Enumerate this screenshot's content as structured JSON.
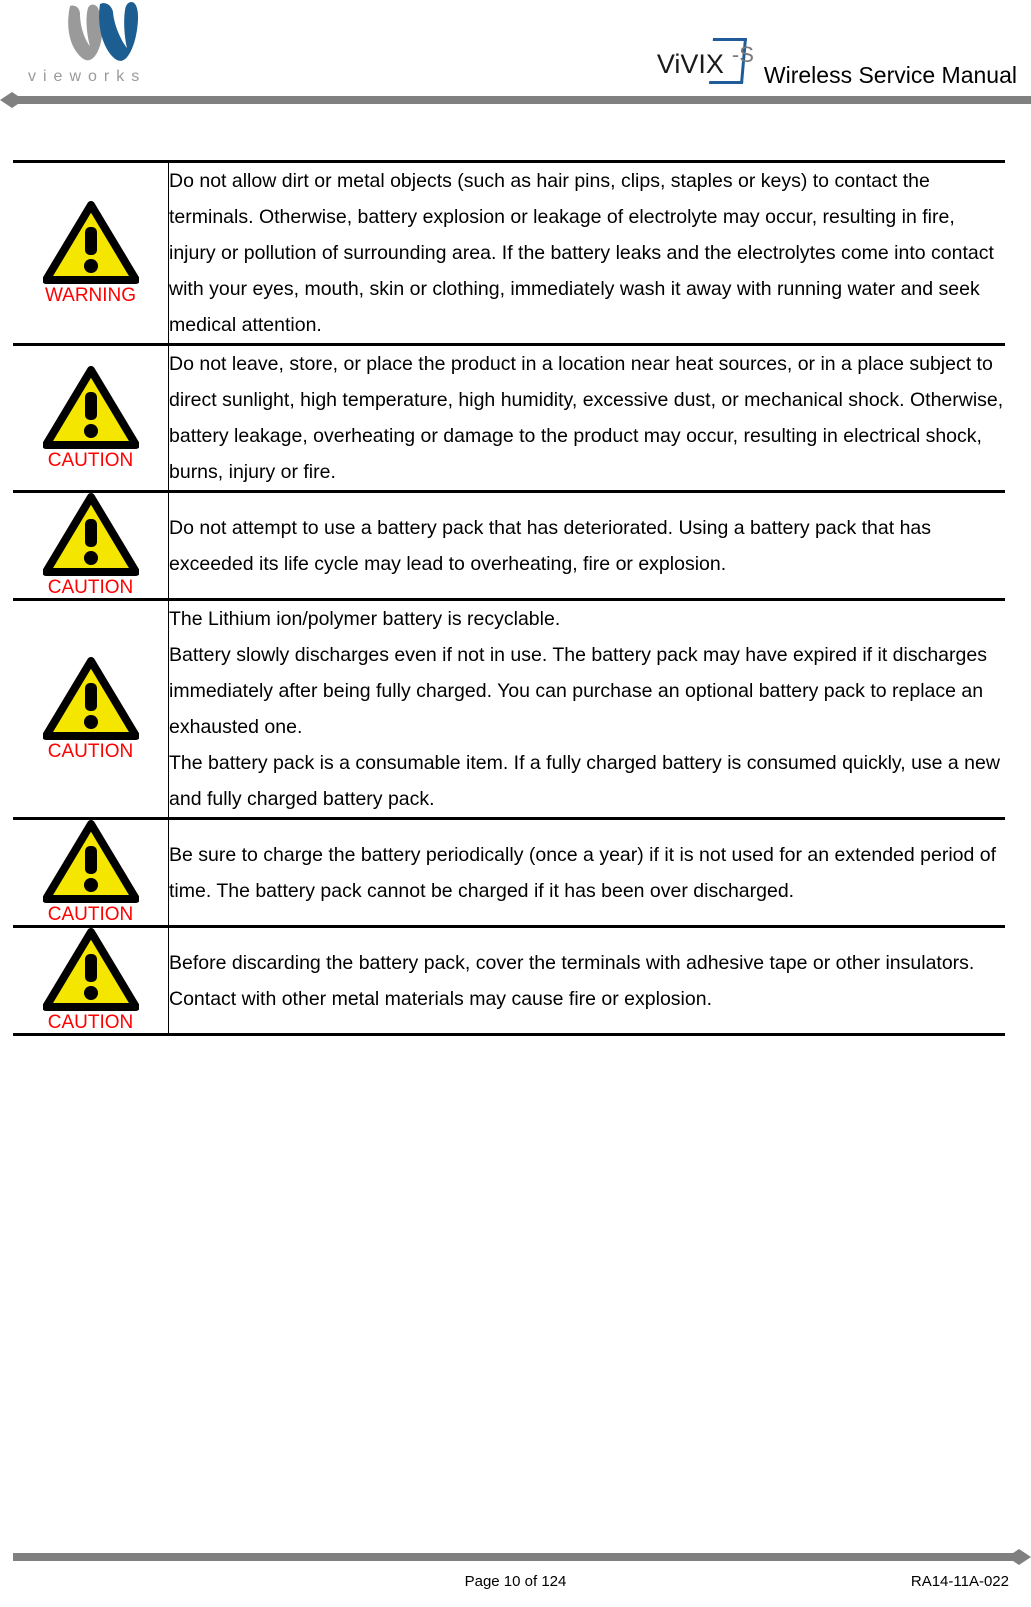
{
  "header": {
    "logo_word": "vieworks",
    "logo_icon": "vieworks-w-logo",
    "product_name_part1": "ViVIX",
    "product_name_part2": "-S",
    "manual_title": "Wireless Service Manual",
    "accent_color": "#1f5c99",
    "rule_color": "#808080"
  },
  "table": {
    "rows": [
      {
        "icon": "warning-triangle-icon",
        "icon_label": "WARNING",
        "paragraphs": [
          "Do not allow dirt or metal objects (such as hair pins, clips, staples or keys) to contact the terminals. Otherwise, battery explosion or leakage of electrolyte may occur, resulting in fire, injury or pollution of surrounding area. If the battery leaks and the electrolytes come into contact with your eyes, mouth, skin or clothing, immediately wash it away with running water and seek medical attention."
        ]
      },
      {
        "icon": "caution-triangle-icon",
        "icon_label": "CAUTION",
        "paragraphs": [
          "Do not leave, store, or place the product in a location near heat sources, or in a place subject to direct sunlight, high temperature, high humidity, excessive dust, or mechanical shock. Otherwise, battery leakage, overheating or damage to the product may occur, resulting in electrical shock, burns, injury or fire."
        ]
      },
      {
        "icon": "caution-triangle-icon",
        "icon_label": "CAUTION",
        "paragraphs": [
          "Do not attempt to use a battery pack that has deteriorated. Using a battery pack that has exceeded its life cycle may lead to overheating, fire or explosion."
        ]
      },
      {
        "icon": "caution-triangle-icon",
        "icon_label": "CAUTION",
        "paragraphs": [
          "The Lithium ion/polymer battery is recyclable.",
          "Battery slowly discharges even if not in use. The battery pack may have expired if it discharges immediately after being fully charged. You can purchase an optional battery pack to replace an exhausted one.",
          "The battery pack is a consumable item. If a fully charged battery is consumed quickly, use a new and fully charged battery pack."
        ]
      },
      {
        "icon": "caution-triangle-icon",
        "icon_label": "CAUTION",
        "paragraphs": [
          "Be sure to charge the battery periodically (once a year) if it is not used for an extended period of time. The battery pack cannot be charged if it has been over discharged."
        ]
      },
      {
        "icon": "caution-triangle-icon",
        "icon_label": "CAUTION",
        "paragraphs": [
          "Before discarding the battery pack, cover the terminals with adhesive tape or other insulators. Contact with other metal materials may cause fire or explosion."
        ]
      }
    ]
  },
  "footer": {
    "page_label": "Page 10 of 124",
    "document_number": "RA14-11A-022",
    "rule_color": "#808080"
  },
  "colors": {
    "hazard_fill": "#f5e600",
    "hazard_stroke": "#000000",
    "hazard_label": "#ff0000",
    "brand_blue": "#1f5c99",
    "brand_gray": "#9a9a9a"
  }
}
